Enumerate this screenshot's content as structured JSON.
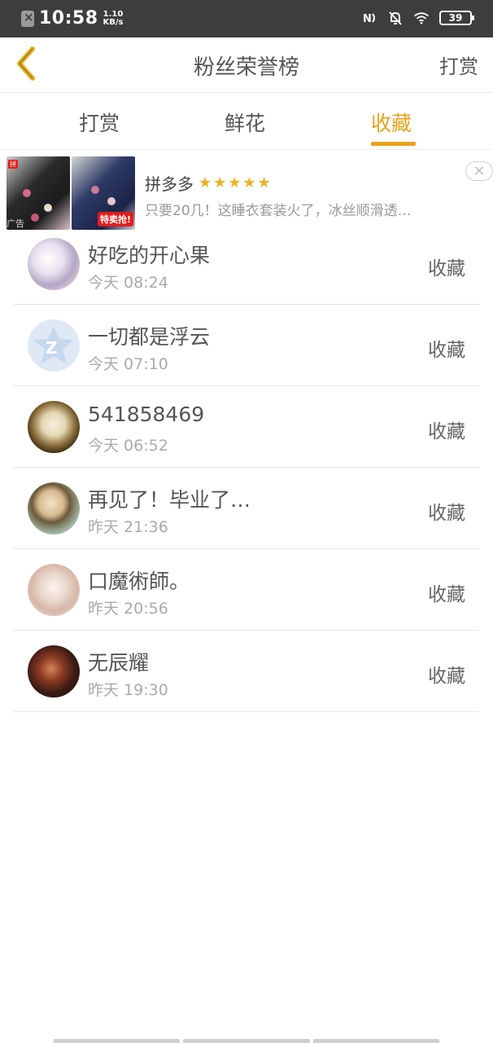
{
  "status_bar": {
    "time": "10:58",
    "speed_value": "1.10",
    "speed_unit": "KB/s",
    "battery": "39"
  },
  "header": {
    "title": "粉丝荣誉榜",
    "right_action": "打赏"
  },
  "tabs": [
    {
      "label": "打赏",
      "active": false
    },
    {
      "label": "鲜花",
      "active": false
    },
    {
      "label": "收藏",
      "active": true
    }
  ],
  "ad": {
    "brand": "拼多多",
    "stars": "★★★★★",
    "description": "只要20几！这睡衣套装火了，冰丝顺滑透…",
    "sale_tag": "特卖抢!",
    "ad_label": "广告",
    "close": "×"
  },
  "list": [
    {
      "name": "好吃的开心果",
      "time": "今天 08:24",
      "action": "收藏"
    },
    {
      "name": "一切都是浮云",
      "time": "今天 07:10",
      "action": "收藏"
    },
    {
      "name": "541858469",
      "time": "今天 06:52",
      "action": "收藏"
    },
    {
      "name": "再见了！毕业了…",
      "time": "昨天 21:36",
      "action": "收藏"
    },
    {
      "name": "口魔術師。",
      "time": "昨天 20:56",
      "action": "收藏"
    },
    {
      "name": "无辰耀",
      "time": "昨天 19:30",
      "action": "收藏"
    }
  ],
  "colors": {
    "accent": "#e9a31b",
    "status_bar_bg": "#3d3d3d"
  }
}
